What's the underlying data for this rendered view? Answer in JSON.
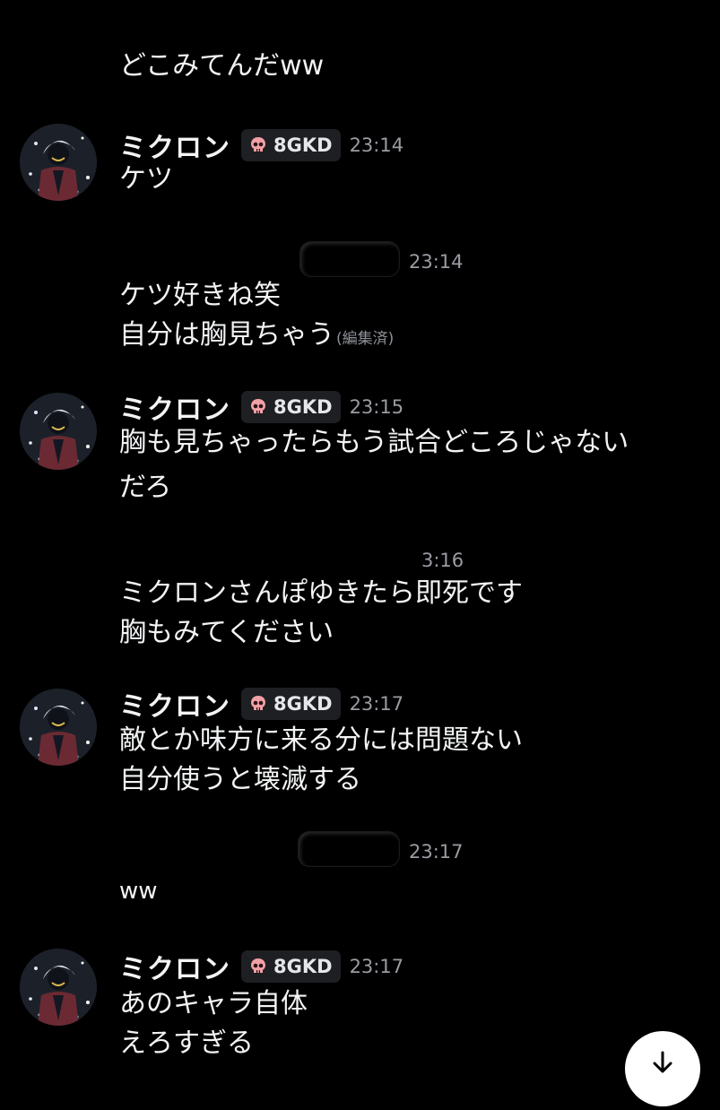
{
  "colors": {
    "background": "#000000",
    "text": "#f2f3f5",
    "timestamp": "#9a9ca3",
    "tag_background": "#1e1f22",
    "skull": "#f2a0a6"
  },
  "messages": {
    "m0": {
      "lines": [
        "どこみてんだww"
      ]
    },
    "m1": {
      "author": "ミクロン",
      "tag": "8GKD",
      "tag_icon": "skull-icon",
      "time": "23:14",
      "lines": [
        "ケツ"
      ]
    },
    "m2": {
      "author": "",
      "time": "23:14",
      "lines": [
        "ケツ好きね笑",
        "自分は胸見ちゃう"
      ],
      "edited": "(編集済)"
    },
    "m3": {
      "author": "ミクロン",
      "tag": "8GKD",
      "tag_icon": "skull-icon",
      "time": "23:15",
      "lines": [
        "胸も見ちゃったらもう試合どころじゃない",
        "だろ"
      ]
    },
    "m4": {
      "author": "",
      "time": "3:16",
      "lines": [
        "ミクロンさんぽゆきたら即死です",
        "胸もみてください"
      ]
    },
    "m5": {
      "author": "ミクロン",
      "tag": "8GKD",
      "tag_icon": "skull-icon",
      "time": "23:17",
      "lines": [
        "敵とか味方に来る分には問題ない",
        "自分使うと壊滅する"
      ]
    },
    "m6": {
      "author": "",
      "time": "23:17",
      "lines": [
        "ww"
      ]
    },
    "m7": {
      "author": "ミクロン",
      "tag": "8GKD",
      "tag_icon": "skull-icon",
      "time": "23:17",
      "lines": [
        "あのキャラ自体",
        "えろすぎる"
      ]
    }
  },
  "jump_button": {
    "icon": "arrow-down-icon"
  }
}
